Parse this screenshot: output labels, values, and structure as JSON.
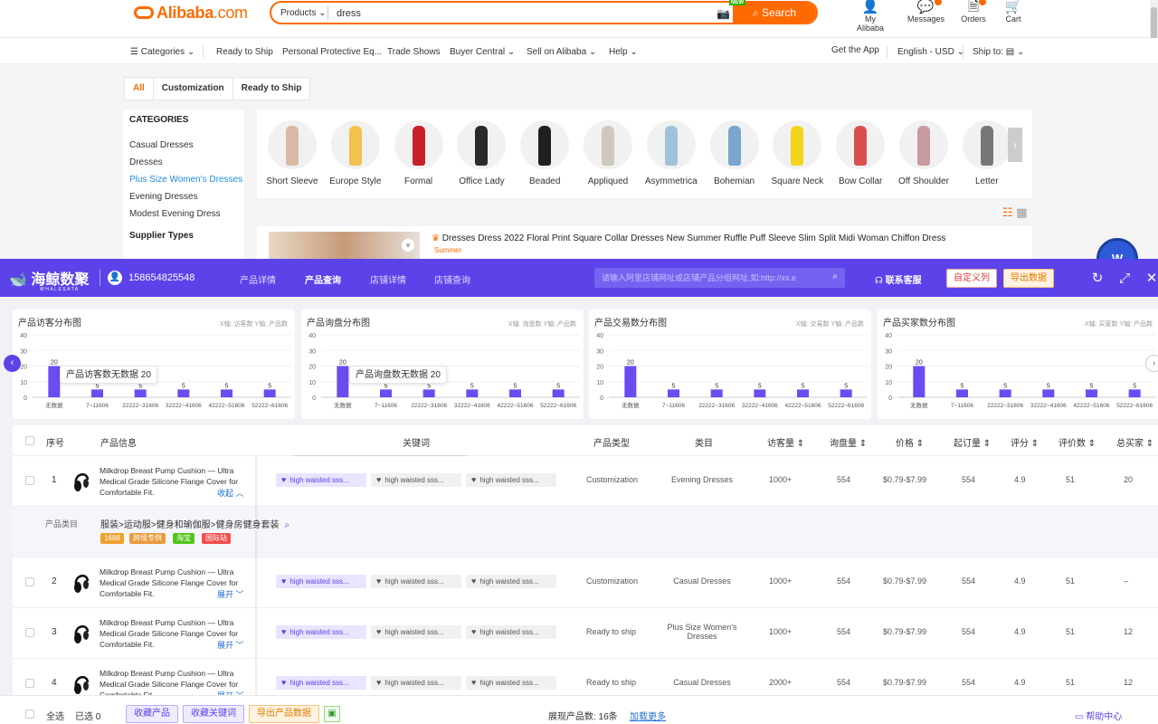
{
  "header": {
    "logo_text": "Alibaba",
    "logo_suffix": ".com",
    "search_scope": "Products",
    "search_value": "dress",
    "search_button": "Search",
    "new_tag": "NEW",
    "icons": [
      {
        "label": "My Alibaba",
        "icon": "user-icon"
      },
      {
        "label": "Messages",
        "icon": "message-icon"
      },
      {
        "label": "Orders",
        "icon": "orders-icon"
      },
      {
        "label": "Cart",
        "icon": "cart-icon"
      }
    ]
  },
  "nav": {
    "categories": "Categories",
    "ready_to_ship": "Ready to Ship",
    "ppe": "Personal Protective Eq...",
    "trade_shows": "Trade Shows",
    "buyer_central": "Buyer Central",
    "sell": "Sell on Alibaba",
    "help": "Help",
    "get_app": "Get the App",
    "language": "English - USD",
    "ship_to": "Ship to:"
  },
  "filter_tabs": [
    "All",
    "Customization",
    "Ready to Ship"
  ],
  "sidebar": {
    "title": "CATEGORIES",
    "items": [
      "Casual Dresses",
      "Dresses",
      "Plus Size Women's Dresses",
      "Evening Dresses",
      "Modest Evening Dress"
    ],
    "supplier_title": "Supplier Types"
  },
  "styles": [
    "Short Sleeve",
    "Europe Style",
    "Formal",
    "Office Lady",
    "Beaded",
    "Appliqued",
    "Asymmetrica",
    "Bohemian",
    "Square Neck",
    "Bow Collar",
    "Off Shoulder",
    "Letter"
  ],
  "preview": {
    "title": "Dresses Dress 2022 Floral Print Square Collar Dresses New Summer Ruffle Puff Sleeve Slim Split Midi Woman Chiffon Dress",
    "tag": "Summer"
  },
  "panel": {
    "brand": "海鲸数聚",
    "brand_sub": "WHALESATA",
    "user": "158654825548",
    "tabs": [
      "产品详情",
      "产品查询",
      "店铺详情",
      "店铺查询"
    ],
    "search_placeholder": "请输入阿里店铺网址或店铺产品分组网址,如:http://xx.e",
    "service": "联系客服",
    "custom_columns": "自定义列",
    "export": "导出数据"
  },
  "chart_data": [
    {
      "type": "bar",
      "title": "产品访客分布图",
      "xnote": "X轴: 访客数",
      "ynote": "Y轴: 产品数",
      "categories": [
        "无数据",
        "7~11606",
        "22222~31606",
        "32222~41606",
        "42222~51606",
        "52222~61606"
      ],
      "values": [
        20,
        5,
        5,
        5,
        5,
        5
      ],
      "yticks": [
        0,
        10,
        20,
        30,
        40
      ],
      "ylim": [
        0,
        40
      ],
      "tooltip": "产品访客数无数据 20"
    },
    {
      "type": "bar",
      "title": "产品询盘分布图",
      "xnote": "X轴: 询盘数",
      "ynote": "Y轴: 产品数",
      "categories": [
        "无数据",
        "7~11606",
        "22222~31606",
        "32222~41606",
        "42222~51606",
        "52222~61606"
      ],
      "values": [
        20,
        5,
        5,
        5,
        5,
        5
      ],
      "yticks": [
        0,
        10,
        20,
        30,
        40
      ],
      "ylim": [
        0,
        40
      ],
      "tooltip": "产品询盘数无数据 20"
    },
    {
      "type": "bar",
      "title": "产品交易数分布图",
      "xnote": "X轴: 交易数",
      "ynote": "Y轴: 产品数",
      "categories": [
        "无数据",
        "7~11606",
        "22222~31606",
        "32222~41606",
        "42222~51606",
        "52222~61606"
      ],
      "values": [
        20,
        5,
        5,
        5,
        5,
        5
      ],
      "yticks": [
        0,
        10,
        20,
        30,
        40
      ],
      "ylim": [
        0,
        40
      ],
      "tooltip": ""
    },
    {
      "type": "bar",
      "title": "产品买家数分布图",
      "xnote": "X轴: 买家数",
      "ynote": "Y轴: 产品数",
      "categories": [
        "无数据",
        "7~11606",
        "22222~31606",
        "32222~41606",
        "42222~51606",
        "52222~61606"
      ],
      "values": [
        20,
        5,
        5,
        5,
        5,
        5
      ],
      "yticks": [
        0,
        10,
        20,
        30,
        40
      ],
      "ylim": [
        0,
        40
      ],
      "tooltip": ""
    }
  ],
  "table": {
    "headers": [
      "序号",
      "产品信息",
      "关键词",
      "产品类型",
      "类目",
      "访客量",
      "询盘量",
      "价格",
      "起订量",
      "评分",
      "评价数",
      "总买家"
    ],
    "rows": [
      {
        "idx": "1",
        "name": "Milkdrop Breast Pump Cushion — Ultra Medical Grade Silicone Flange Cover for Comfortable Fit.",
        "toggle": "收起",
        "keywords": [
          "high waisted sss...",
          "high waisted sss...",
          "high waisted sss..."
        ],
        "type": "Customization",
        "category": "Evening Dresses",
        "visitors": "1000+",
        "inquiries": "554",
        "price": "$0.79-$7.99",
        "moq": "554",
        "rating": "4.9",
        "reviews": "51",
        "buyers": "20"
      },
      {
        "idx": "2",
        "name": "Milkdrop Breast Pump Cushion — Ultra Medical Grade Silicone Flange Cover for Comfortable Fit.",
        "toggle": "展开",
        "keywords": [
          "high waisted sss...",
          "high waisted sss...",
          "high waisted sss..."
        ],
        "type": "Customization",
        "category": "Casual Dresses",
        "visitors": "1000+",
        "inquiries": "554",
        "price": "$0.79-$7.99",
        "moq": "554",
        "rating": "4.9",
        "reviews": "51",
        "buyers": "–"
      },
      {
        "idx": "3",
        "name": "Milkdrop Breast Pump Cushion — Ultra Medical Grade Silicone Flange Cover for Comfortable Fit.",
        "toggle": "展开",
        "keywords": [
          "high waisted sss...",
          "high waisted sss...",
          "high waisted sss..."
        ],
        "type": "Ready to ship",
        "category": "Plus Size Women's Dresses",
        "visitors": "1000+",
        "inquiries": "554",
        "price": "$0.79-$7.99",
        "moq": "554",
        "rating": "4.9",
        "reviews": "51",
        "buyers": "12"
      },
      {
        "idx": "4",
        "name": "Milkdrop Breast Pump Cushion — Ultra Medical Grade Silicone Flange Cover for Comfortable Fit.",
        "toggle": "展开",
        "keywords": [
          "high waisted sss...",
          "high waisted sss...",
          "high waisted sss..."
        ],
        "type": "Ready to ship",
        "category": "Casual Dresses",
        "visitors": "2000+",
        "inquiries": "554",
        "price": "$0.79-$7.99",
        "moq": "554",
        "rating": "4.9",
        "reviews": "51",
        "buyers": "12"
      }
    ],
    "detail": {
      "label": "产品类目",
      "path": "服装>运动服>健身和瑜伽服>健身房健身套装",
      "chips": [
        {
          "text": "1688",
          "color": "#f0a030"
        },
        {
          "text": "跨境专供",
          "color": "#e89b3c"
        },
        {
          "text": "淘宝",
          "color": "#52c41a"
        },
        {
          "text": "国际站",
          "color": "#f04d4d"
        }
      ]
    }
  },
  "footer": {
    "select_all": "全选",
    "selected": "已选 0",
    "fav_products": "收藏产品",
    "fav_keywords": "收藏关键词",
    "export_products": "导出产品数据",
    "shown": "展现产品数: 16条",
    "load_more": "加载更多",
    "help": "帮助中心"
  }
}
